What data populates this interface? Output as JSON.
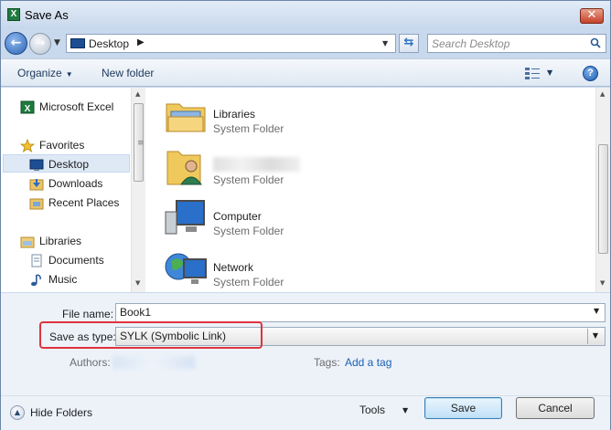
{
  "window": {
    "title": "Save As",
    "app_icon_letter": "X"
  },
  "nav": {
    "back_arrow": "←",
    "forward_arrow": "→",
    "history_caret": "▼"
  },
  "address": {
    "location": "Desktop",
    "separator": "▶",
    "dropdown": "▼"
  },
  "refresh_glyph": "⇆",
  "search": {
    "placeholder": "Search Desktop"
  },
  "toolbar": {
    "organize_label": "Organize",
    "organize_caret": "▼",
    "new_folder_label": "New folder",
    "view_caret": "▼",
    "help_glyph": "?"
  },
  "sidebar": {
    "items": [
      {
        "label": "Microsoft Excel",
        "icon": "excel-icon"
      },
      {
        "label": "Favorites",
        "icon": "star-icon"
      },
      {
        "label": "Desktop",
        "icon": "desktop-icon",
        "selected": true
      },
      {
        "label": "Downloads",
        "icon": "downloads-icon"
      },
      {
        "label": "Recent Places",
        "icon": "recent-places-icon"
      },
      {
        "label": "Libraries",
        "icon": "libraries-icon"
      },
      {
        "label": "Documents",
        "icon": "documents-icon"
      },
      {
        "label": "Music",
        "icon": "music-icon"
      }
    ]
  },
  "files": [
    {
      "name": "Libraries",
      "type": "System Folder",
      "icon": "libraries-folder-icon"
    },
    {
      "name": "",
      "type": "System Folder",
      "icon": "user-folder-icon",
      "name_redacted": true
    },
    {
      "name": "Computer",
      "type": "System Folder",
      "icon": "computer-icon"
    },
    {
      "name": "Network",
      "type": "System Folder",
      "icon": "network-icon"
    }
  ],
  "form": {
    "file_name_label": "File name:",
    "file_name_value": "Book1",
    "save_type_label": "Save as type:",
    "save_type_value": "SYLK (Symbolic Link)",
    "authors_label": "Authors:",
    "tags_label": "Tags:",
    "add_tag_link": "Add a tag"
  },
  "footer": {
    "hide_folders_label": "Hide Folders",
    "tools_label": "Tools",
    "tools_caret": "▼",
    "save_label": "Save",
    "cancel_label": "Cancel"
  },
  "colors": {
    "highlight": "#e0323e",
    "accent": "#1a5fb4",
    "close": "#c7412a"
  }
}
